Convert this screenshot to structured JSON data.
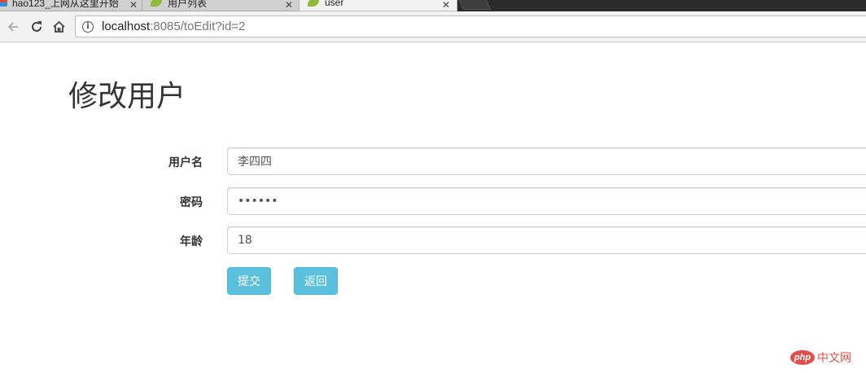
{
  "browser": {
    "tabs": [
      {
        "label": "hao123_上网从这里开始",
        "close": "✕"
      },
      {
        "label": "用户列表",
        "close": "✕"
      },
      {
        "label": "user",
        "close": "✕"
      }
    ],
    "url_host": "localhost",
    "url_path": ":8085/toEdit?id=2"
  },
  "page": {
    "title": "修改用户",
    "fields": [
      {
        "label": "用户名",
        "value": "李四四"
      },
      {
        "label": "密码",
        "value": "••••••"
      },
      {
        "label": "年龄",
        "value": "18"
      }
    ],
    "submit_label": "提交",
    "back_label": "返回"
  },
  "watermark": {
    "badge": "php",
    "text": "中文网"
  }
}
